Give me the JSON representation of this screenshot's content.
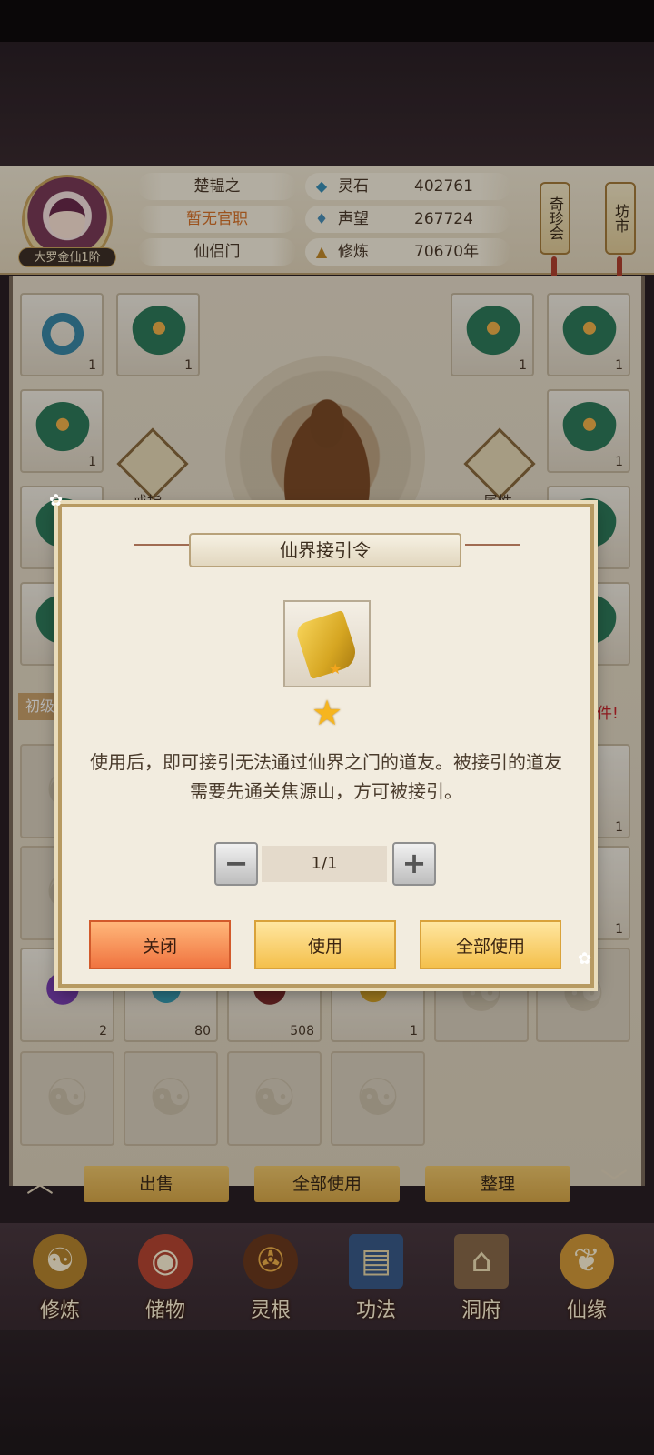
{
  "header": {
    "rank": "大罗金仙1阶",
    "name": "楚韫之",
    "official_post": "暂无官职",
    "sect": "仙侣门",
    "resources": [
      {
        "icon": "spirit-stone-icon",
        "label": "灵石",
        "value": "402761"
      },
      {
        "icon": "reputation-icon",
        "label": "声望",
        "value": "267724"
      },
      {
        "icon": "cultivation-icon",
        "label": "修炼",
        "value": "70670年"
      }
    ],
    "side_buttons": [
      "奇珍会",
      "坊市"
    ]
  },
  "equipment": {
    "left_slots": [
      {
        "art": "ring",
        "count": "1"
      },
      {
        "art": "leaf",
        "count": "1"
      },
      {
        "art": "leaf",
        "count": "1"
      }
    ],
    "right_slots": [
      {
        "art": "leaf",
        "count": "1"
      },
      {
        "art": "leaf",
        "count": "1"
      },
      {
        "art": "leaf",
        "count": "1"
      }
    ],
    "ring_label": "戒指",
    "attr_label": "属性"
  },
  "bag": {
    "section_tab": "初级",
    "hint": "多件!",
    "visible_counts": [
      "1",
      "1",
      "2",
      "80",
      "508",
      "1"
    ],
    "actions": [
      "出售",
      "全部使用",
      "整理"
    ]
  },
  "nav": [
    {
      "label": "修炼",
      "icon": "meditation-icon"
    },
    {
      "label": "储物",
      "icon": "bag-icon"
    },
    {
      "label": "灵根",
      "icon": "spirit-root-icon"
    },
    {
      "label": "功法",
      "icon": "book-icon"
    },
    {
      "label": "洞府",
      "icon": "cave-icon"
    },
    {
      "label": "仙缘",
      "icon": "gourd-icon"
    }
  ],
  "dialog": {
    "title": "仙界接引令",
    "description": "使用后，即可接引无法通过仙界之门的道友。被接引的道友需要先通关焦源山，方可被接引。",
    "stepper_value": "1/1",
    "minus": "−",
    "plus": "+",
    "buttons": {
      "close": "关闭",
      "use": "使用",
      "use_all": "全部使用"
    }
  },
  "colors": {
    "accent_gold": "#f4c04c",
    "close_orange": "#f07440",
    "hint_red": "#c9242b"
  }
}
